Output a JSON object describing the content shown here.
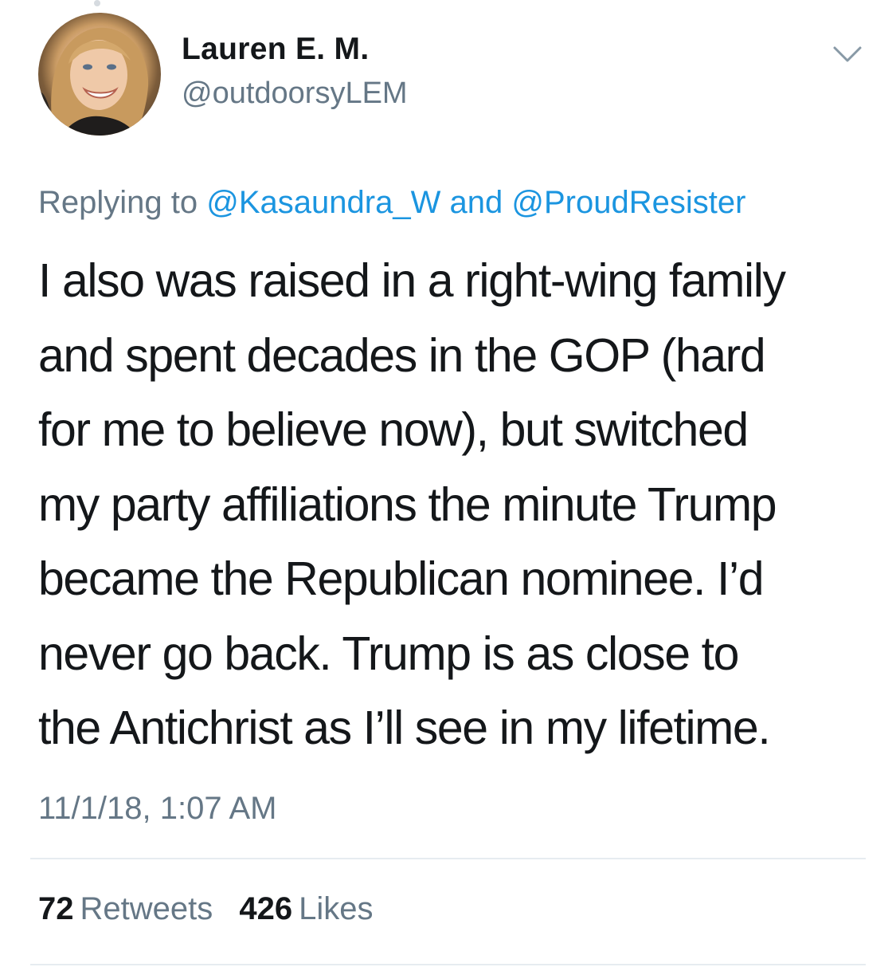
{
  "tweet": {
    "author": {
      "display_name": "Lauren E. M.",
      "handle": "@outdoorsyLEM",
      "avatar_icon": "profile-photo"
    },
    "menu_icon": "chevron-down-icon",
    "reply": {
      "prefix": "Replying to",
      "mentions": [
        "@Kasaundra_W",
        "@ProudResister"
      ],
      "joiner": "and"
    },
    "body_lines": [
      "I also was raised in a right-wing family",
      "and spent decades in the GOP (hard",
      "for me to believe now), but switched",
      "my party affiliations the minute Trump",
      "became the Republican nominee.  I’d",
      "never go back.  Trump is as close to",
      "the Antichrist as I’ll see in my lifetime."
    ],
    "timestamp": "11/1/18, 1:07 AM",
    "stats": {
      "retweets_count": "72",
      "retweets_label": "Retweets",
      "likes_count": "426",
      "likes_label": "Likes"
    }
  },
  "colors": {
    "text": "#14171a",
    "secondary": "#657786",
    "link": "#1b95e0",
    "divider": "#e6ecf0",
    "background": "#ffffff"
  }
}
